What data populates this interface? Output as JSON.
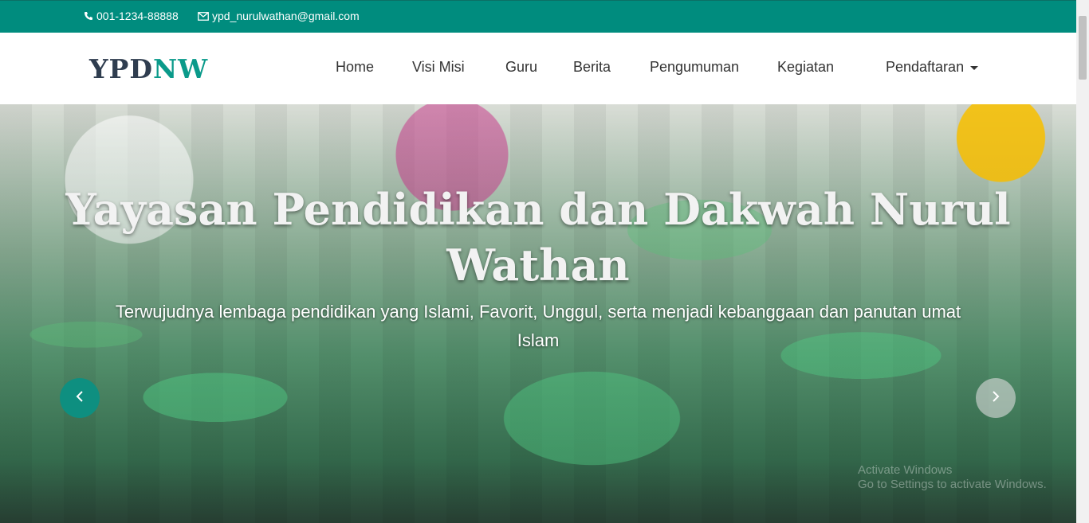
{
  "topbar": {
    "phone": "001-1234-88888",
    "email": "ypd_nurulwathan@gmail.com",
    "color": "#008c7e"
  },
  "brand": {
    "part1": "YPD",
    "part2": "NW"
  },
  "nav": {
    "home": "Home",
    "visi_misi": "Visi Misi",
    "guru": "Guru",
    "berita": "Berita",
    "pengumuman": "Pengumuman",
    "kegiatan": "Kegiatan",
    "pendaftaran": "Pendaftaran"
  },
  "hero": {
    "title": "Yayasan Pendidikan dan Dakwah Nurul Wathan",
    "subtitle": "Terwujudnya lembaga pendidikan yang Islami, Favorit, Unggul, serta menjadi kebanggaan dan panutan umat Islam",
    "prev_icon": "chevron-left-icon",
    "next_icon": "chevron-right-icon"
  },
  "watermark": {
    "line1": "Activate Windows",
    "line2": "Go to Settings to activate Windows."
  }
}
